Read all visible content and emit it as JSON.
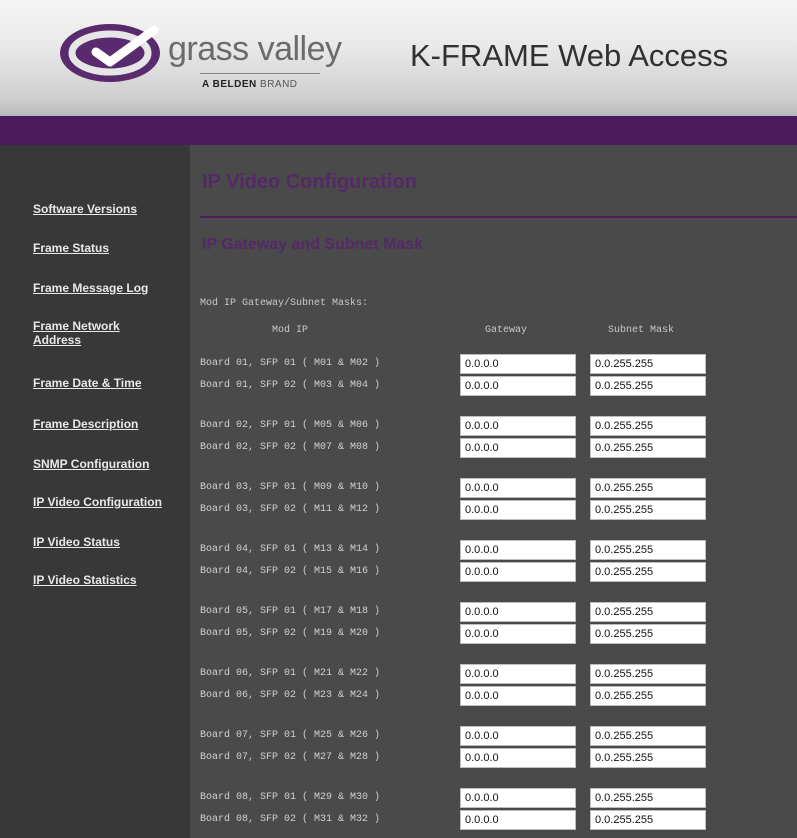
{
  "header": {
    "brand_name": "grass valley",
    "brand_sub_bold": "A BELDEN",
    "brand_sub_rest": " BRAND",
    "app_title": "K-FRAME Web Access",
    "logo_colors": {
      "circle": "#5a2a6e",
      "check": "#ffffff"
    }
  },
  "sidebar": {
    "items": [
      "Software Versions",
      "Frame Status",
      "Frame Message Log",
      "Frame Network Address",
      "Frame Date & Time",
      "Frame Description",
      "SNMP Configuration",
      "IP Video Configuration",
      "IP Video Status",
      "IP Video Statistics"
    ]
  },
  "main": {
    "page_title": "IP Video Configuration",
    "section_title": "IP Gateway and Subnet Mask",
    "table_caption": "Mod IP Gateway/Subnet Masks:",
    "columns": [
      "Mod IP",
      "Gateway",
      "Subnet Mask"
    ],
    "rows": [
      {
        "label": "Board 01, SFP 01 ( M01 & M02 )",
        "gateway": "0.0.0.0",
        "subnet": "0.0.255.255"
      },
      {
        "label": "Board 01, SFP 02 ( M03 & M04 )",
        "gateway": "0.0.0.0",
        "subnet": "0.0.255.255"
      },
      {
        "label": "Board 02, SFP 01 ( M05 & M06 )",
        "gateway": "0.0.0.0",
        "subnet": "0.0.255.255"
      },
      {
        "label": "Board 02, SFP 02 ( M07 & M08 )",
        "gateway": "0.0.0.0",
        "subnet": "0.0.255.255"
      },
      {
        "label": "Board 03, SFP 01 ( M09 & M10 )",
        "gateway": "0.0.0.0",
        "subnet": "0.0.255.255"
      },
      {
        "label": "Board 03, SFP 02 ( M11 & M12 )",
        "gateway": "0.0.0.0",
        "subnet": "0.0.255.255"
      },
      {
        "label": "Board 04, SFP 01 ( M13 & M14 )",
        "gateway": "0.0.0.0",
        "subnet": "0.0.255.255"
      },
      {
        "label": "Board 04, SFP 02 ( M15 & M16 )",
        "gateway": "0.0.0.0",
        "subnet": "0.0.255.255"
      },
      {
        "label": "Board 05, SFP 01 ( M17 & M18 )",
        "gateway": "0.0.0.0",
        "subnet": "0.0.255.255"
      },
      {
        "label": "Board 05, SFP 02 ( M19 & M20 )",
        "gateway": "0.0.0.0",
        "subnet": "0.0.255.255"
      },
      {
        "label": "Board 06, SFP 01 ( M21 & M22 )",
        "gateway": "0.0.0.0",
        "subnet": "0.0.255.255"
      },
      {
        "label": "Board 06, SFP 02 ( M23 & M24 )",
        "gateway": "0.0.0.0",
        "subnet": "0.0.255.255"
      },
      {
        "label": "Board 07, SFP 01 ( M25 & M26 )",
        "gateway": "0.0.0.0",
        "subnet": "0.0.255.255"
      },
      {
        "label": "Board 07, SFP 02 ( M27 & M28 )",
        "gateway": "0.0.0.0",
        "subnet": "0.0.255.255"
      },
      {
        "label": "Board 08, SFP 01 ( M29 & M30 )",
        "gateway": "0.0.0.0",
        "subnet": "0.0.255.255"
      },
      {
        "label": "Board 08, SFP 02 ( M31 & M32 )",
        "gateway": "0.0.0.0",
        "subnet": "0.0.255.255"
      }
    ]
  },
  "colors": {
    "accent_purple": "#4d1c5e",
    "title_purple": "#552868",
    "sidebar_bg": "#383838",
    "main_bg": "#4a4a4a"
  }
}
